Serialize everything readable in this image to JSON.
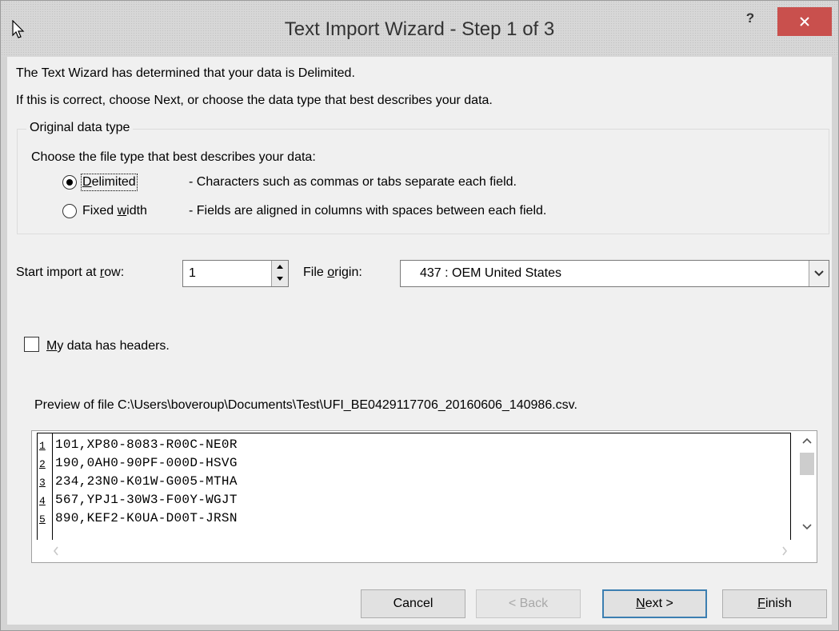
{
  "window": {
    "title": "Text Import Wizard - Step 1 of 3",
    "help_label": "?"
  },
  "intro": {
    "line1": "The Text Wizard has determined that your data is Delimited.",
    "line2": "If this is correct, choose Next, or choose the data type that best describes your data."
  },
  "data_type": {
    "group_label": "Original data type",
    "prompt": "Choose the file type that best describes your data:",
    "options": [
      {
        "label": "Delimited",
        "accel": "D",
        "rest": "elimited",
        "description": "- Characters such as commas or tabs separate each field.",
        "selected": true
      },
      {
        "label": "Fixed width",
        "pre": "Fixed ",
        "accel": "w",
        "rest": "idth",
        "description": "- Fields are aligned in columns with spaces between each field.",
        "selected": false
      }
    ]
  },
  "start_row": {
    "label_pre": "Start import at ",
    "label_accel": "r",
    "label_post": "ow:",
    "value": "1"
  },
  "file_origin": {
    "label_pre": "File ",
    "label_accel": "o",
    "label_post": "rigin:",
    "value": "437 : OEM United States"
  },
  "headers": {
    "accel": "M",
    "label_rest": "y data has headers.",
    "checked": false
  },
  "preview": {
    "label": "Preview of file C:\\Users\\boveroup\\Documents\\Test\\UFI_BE0429117706_20160606_140986.csv.",
    "rows": [
      {
        "num": "1",
        "text": "101,XP80-8083-R00C-NE0R"
      },
      {
        "num": "2",
        "text": "190,0AH0-90PF-000D-HSVG"
      },
      {
        "num": "3",
        "text": "234,23N0-K01W-G005-MTHA"
      },
      {
        "num": "4",
        "text": "567,YPJ1-30W3-F00Y-WGJT"
      },
      {
        "num": "5",
        "text": "890,KEF2-K0UA-D00T-JRSN"
      }
    ]
  },
  "buttons": {
    "cancel": "Cancel",
    "back": "< Back",
    "next_accel": "N",
    "next_rest": "ext >",
    "finish_accel": "F",
    "finish_rest": "inish"
  },
  "colors": {
    "close_button": "#c9504d",
    "default_button_border": "#3c7fb1"
  }
}
